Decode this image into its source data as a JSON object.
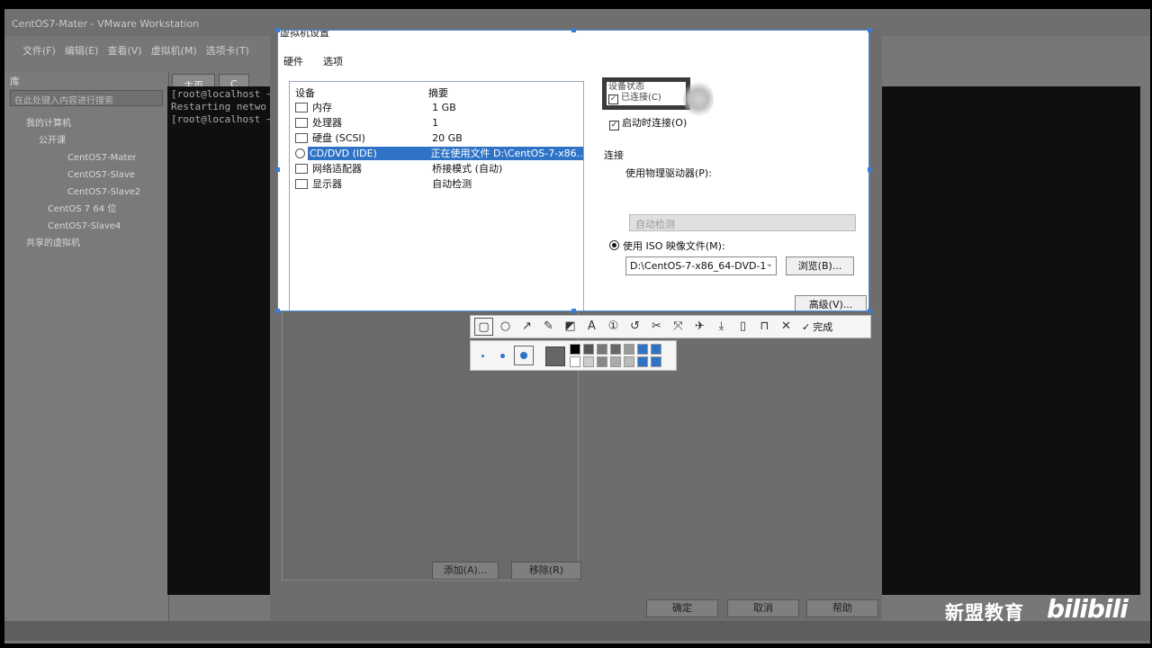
{
  "host": {
    "title": "CentOS7-Mater - VMware Workstation",
    "menu": [
      "文件(F)",
      "编辑(E)",
      "查看(V)",
      "虚拟机(M)",
      "选项卡(T)"
    ],
    "library_label": "库",
    "search_placeholder": "在此处键入内容进行搜索",
    "tree": {
      "my_computer": "我的计算机",
      "group": "公开课",
      "vms": [
        "CentOS7-Mater",
        "CentOS7-Slave",
        "CentOS7-Slave2"
      ],
      "other1": "CentOS 7 64 位",
      "other2": "CentOS7-Slave4",
      "shared": "共享的虚拟机"
    },
    "tabs": [
      "主页",
      "C"
    ],
    "terminal_lines": [
      "[root@localhost ~]#",
      "Restarting netwo",
      "[root@localhost ~]#"
    ]
  },
  "dialog": {
    "title": "虚拟机设置",
    "tabs": [
      "硬件",
      "选项"
    ],
    "columns": {
      "device": "设备",
      "summary": "摘要"
    },
    "devices": [
      {
        "name": "内存",
        "summary": "1 GB",
        "icon": "memory-icon",
        "selected": false
      },
      {
        "name": "处理器",
        "summary": "1",
        "icon": "cpu-icon",
        "selected": false
      },
      {
        "name": "硬盘 (SCSI)",
        "summary": "20 GB",
        "icon": "disk-icon",
        "selected": false
      },
      {
        "name": "CD/DVD (IDE)",
        "summary": "正在使用文件 D:\\CentOS-7-x86...",
        "icon": "cd-icon",
        "selected": true
      },
      {
        "name": "网络适配器",
        "summary": "桥接模式 (自动)",
        "icon": "network-icon",
        "selected": false
      },
      {
        "name": "显示器",
        "summary": "自动检测",
        "icon": "monitor-icon",
        "selected": false
      }
    ],
    "device_status": {
      "heading": "设备状态",
      "connected": "已连接(C)",
      "connect_on_startup": "启动时连接(O)"
    },
    "connection": {
      "heading": "连接",
      "physical_drive": "使用物理驱动器(P):",
      "physical_value": "自动检测",
      "iso_label": "使用 ISO 映像文件(M):",
      "iso_value": "D:\\CentOS-7-x86_64-DVD-1",
      "browse": "浏览(B)...",
      "advanced": "高级(V)..."
    },
    "add": "添加(A)...",
    "remove": "移除(R)",
    "ok": "确定",
    "cancel": "取消",
    "help": "帮助"
  },
  "snip": {
    "done_label": "完成",
    "tools": [
      "rectangle-icon",
      "ellipse-icon",
      "arrow-icon",
      "pen-icon",
      "mosaic-icon",
      "text-icon",
      "number-icon",
      "undo-icon",
      "pin-icon",
      "ocr-icon",
      "translate-icon",
      "save-icon",
      "copy-icon",
      "bookmark-icon",
      "close-icon"
    ],
    "tool_glyphs": [
      "▢",
      "○",
      "↗",
      "✎",
      "◩",
      "A",
      "①",
      "↺",
      "✂",
      "⤧",
      "✈",
      "⤓",
      "▯",
      "⊓",
      "✕"
    ],
    "colors_top": [
      "#000000",
      "#555555",
      "#777777",
      "#666666",
      "#999999",
      "#2f73c7",
      "#2f73c7"
    ],
    "colors_bottom": [
      "#ffffff",
      "#cccccc",
      "#888888",
      "#aaaaaa",
      "#bbbbbb",
      "#2f73c7",
      "#2f73c7"
    ]
  },
  "watermark": {
    "text": "新盟教育",
    "logo": "bilibili"
  }
}
